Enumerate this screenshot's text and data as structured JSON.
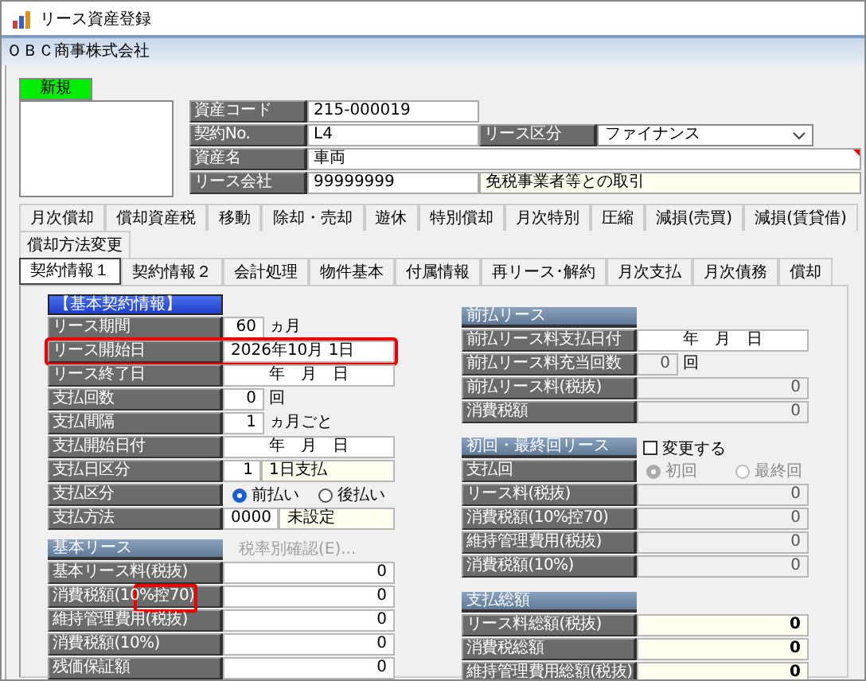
{
  "window": {
    "title": "リース資産登録"
  },
  "company": "ＯＢＣ商事株式会社",
  "status_badge": "新規",
  "header_fields": [
    {
      "label": "資産コード",
      "value": "215-000019"
    },
    {
      "label": "契約No.",
      "value": "L4",
      "extra": {
        "kind": "select",
        "label": "リース区分",
        "value": "ファイナンス"
      }
    },
    {
      "label": "資産名",
      "value": "車両"
    },
    {
      "label": "リース会社",
      "value": "99999999",
      "extra": {
        "kind": "note",
        "value": "免税事業者等との取引"
      }
    }
  ],
  "tab_rows": [
    [
      {
        "label": "月次償却",
        "selected": false
      },
      {
        "label": "償却資産税",
        "selected": false
      },
      {
        "label": "移動",
        "selected": false
      },
      {
        "label": "除却・売却",
        "selected": false
      },
      {
        "label": "遊休",
        "selected": false
      },
      {
        "label": "特別償却",
        "selected": false
      },
      {
        "label": "月次特別",
        "selected": false
      },
      {
        "label": "圧縮",
        "selected": false
      },
      {
        "label": "減損(売買)",
        "selected": false
      },
      {
        "label": "減損(賃貸借)",
        "selected": false
      }
    ],
    [
      {
        "label": "償却方法変更",
        "selected": false
      }
    ],
    [
      {
        "label": "契約情報１",
        "selected": true
      },
      {
        "label": "契約情報２",
        "selected": false
      },
      {
        "label": "会計処理",
        "selected": false
      },
      {
        "label": "物件基本",
        "selected": false
      },
      {
        "label": "付属情報",
        "selected": false
      },
      {
        "label": "再リース･解約",
        "selected": false
      },
      {
        "label": "月次支払",
        "selected": false
      },
      {
        "label": "月次債務",
        "selected": false
      },
      {
        "label": "償却",
        "selected": false
      }
    ]
  ],
  "left_sections": [
    {
      "title": "【基本契約情報】",
      "rows": [
        {
          "label": "リース期間",
          "kind": "number",
          "value": "60",
          "unit": "ヵ月",
          "disabled": false
        },
        {
          "label": "リース開始日",
          "kind": "text",
          "value": "2026年10月 1日",
          "disabled": false,
          "highlighted": true
        },
        {
          "label": "リース終了日",
          "kind": "date",
          "value": "年　月　日",
          "disabled": false
        },
        {
          "label": "支払回数",
          "kind": "number",
          "value": "0",
          "unit": "回",
          "disabled": false
        },
        {
          "label": "支払間隔",
          "kind": "number",
          "value": "1",
          "unit": "ヵ月ごと",
          "disabled": false
        },
        {
          "label": "支払開始日付",
          "kind": "date",
          "value": "年　月　日",
          "disabled": false
        },
        {
          "label": "支払日区分",
          "kind": "pair",
          "value": "1",
          "note": "1日支払"
        },
        {
          "label": "支払区分",
          "kind": "radio",
          "disabled": false,
          "options": [
            {
              "label": "前払い",
              "selected": true
            },
            {
              "label": "後払い",
              "selected": false
            }
          ]
        },
        {
          "label": "支払方法",
          "kind": "pair",
          "value": "0000",
          "note": "未設定"
        }
      ]
    },
    {
      "title": "基本リース",
      "button": {
        "label": "税率別確認(E)...",
        "disabled": true
      },
      "rows": [
        {
          "label": "基本リース料(税抜)",
          "kind": "number",
          "value": "0",
          "disabled": false
        },
        {
          "label": "消費税額(10%控70)",
          "kind": "number",
          "value": "0",
          "disabled": false,
          "label_highlighted": true
        },
        {
          "label": "維持管理費用(税抜)",
          "kind": "number",
          "value": "0",
          "disabled": false
        },
        {
          "label": "消費税額(10%)",
          "kind": "number",
          "value": "0",
          "disabled": false
        },
        {
          "label": "残価保証額",
          "kind": "number",
          "value": "0",
          "disabled": false
        }
      ]
    }
  ],
  "right_sections": [
    {
      "title": "前払リース",
      "rows": [
        {
          "label": "前払リース料支払日付",
          "kind": "date",
          "value": "年　月　日",
          "disabled": false
        },
        {
          "label": "前払リース料充当回数",
          "kind": "number",
          "value": "0",
          "unit": "回",
          "disabled": true
        },
        {
          "label": "前払リース料(税抜)",
          "kind": "number",
          "value": "0",
          "disabled": true
        },
        {
          "label": "消費税額",
          "kind": "number",
          "value": "0",
          "disabled": true
        }
      ]
    },
    {
      "title": "初回・最終回リース",
      "checkbox": {
        "label": "変更する",
        "checked": false
      },
      "rows": [
        {
          "label": "支払回",
          "kind": "radio",
          "disabled": true,
          "options": [
            {
              "label": "初回",
              "selected": true
            },
            {
              "label": "最終回",
              "selected": false
            }
          ]
        },
        {
          "label": "リース料(税抜)",
          "kind": "number",
          "value": "0",
          "disabled": true
        },
        {
          "label": "消費税額(10%控70)",
          "kind": "number",
          "value": "0",
          "disabled": true
        },
        {
          "label": "維持管理費用(税抜)",
          "kind": "number",
          "value": "0",
          "disabled": true
        },
        {
          "label": "消費税額(10%)",
          "kind": "number",
          "value": "0",
          "disabled": true
        }
      ]
    },
    {
      "title": "支払総額",
      "rows": [
        {
          "label": "リース料総額(税抜)",
          "kind": "total",
          "value": "0"
        },
        {
          "label": "消費税総額",
          "kind": "total",
          "value": "0"
        },
        {
          "label": "維持管理費用総額(税抜)",
          "kind": "total",
          "value": "0"
        }
      ]
    }
  ]
}
